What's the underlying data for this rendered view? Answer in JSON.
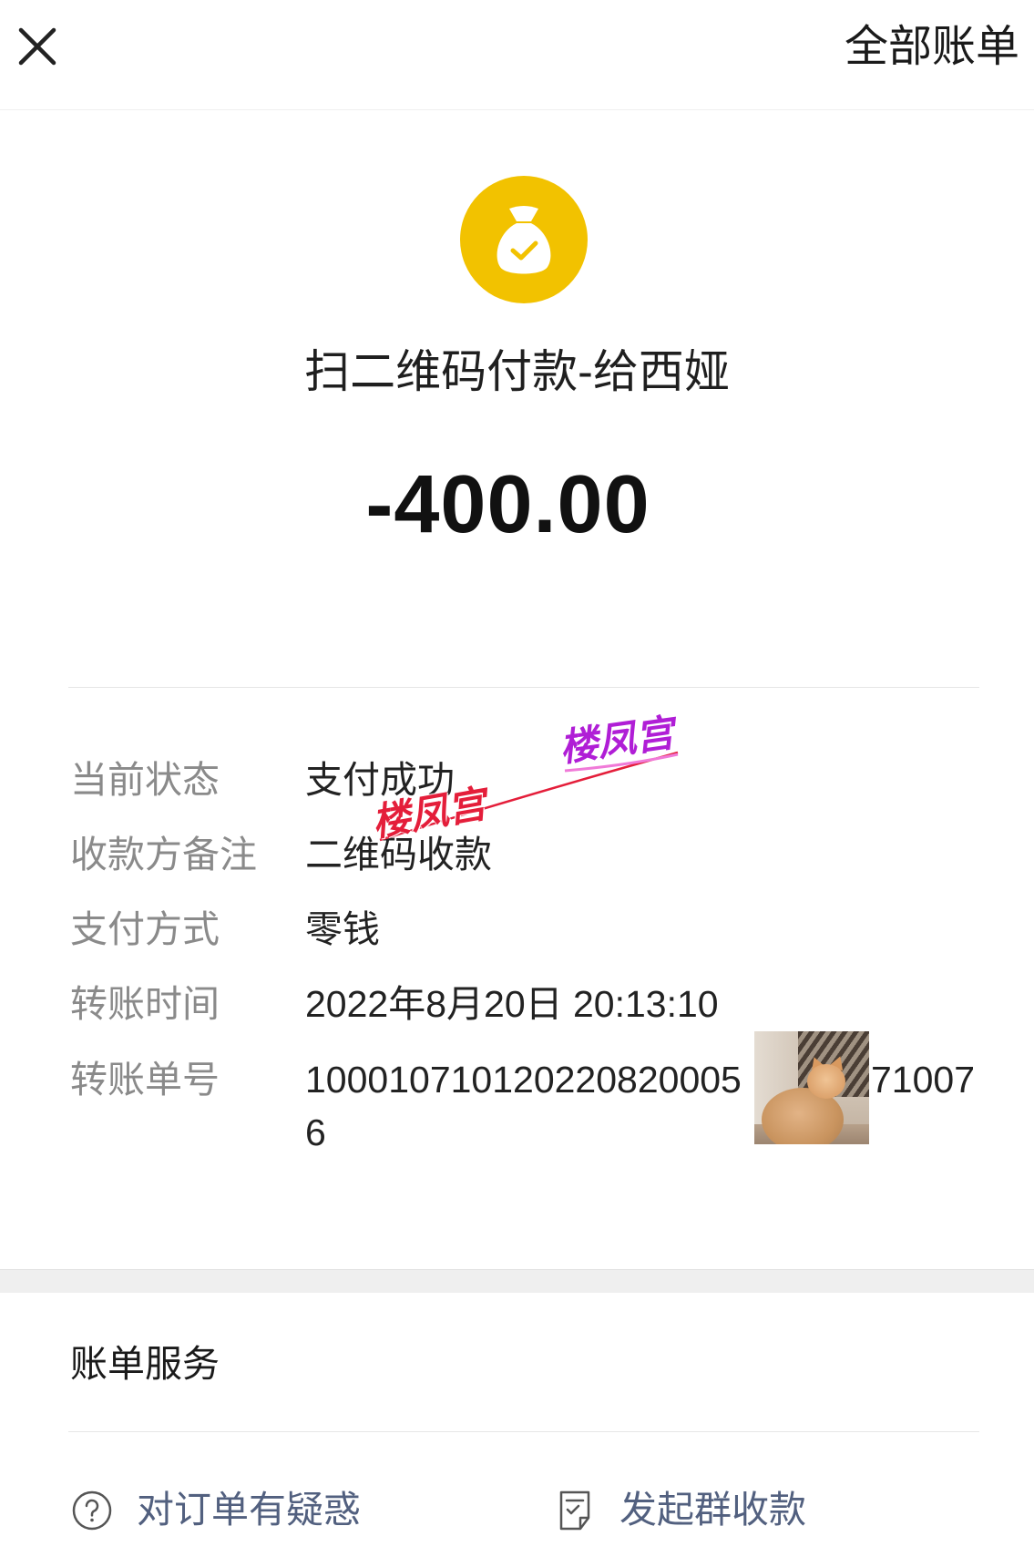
{
  "header": {
    "close_icon": "close-icon",
    "all_bills": "全部账单"
  },
  "summary": {
    "icon": "money-bag-check-icon",
    "icon_color": "#f2c200",
    "title": "扫二维码付款-给西娅",
    "amount": "-400.00"
  },
  "details": {
    "rows": [
      {
        "label": "当前状态",
        "value": "支付成功"
      },
      {
        "label": "收款方备注",
        "value": "二维码收款"
      },
      {
        "label": "支付方式",
        "value": "零钱"
      },
      {
        "label": "转账时间",
        "value": "2022年8月20日 20:13:10"
      },
      {
        "label": "转账单号",
        "value_line1_start": "100010710120220820005",
        "value_line1_end": "71007",
        "value_line2": "6"
      }
    ]
  },
  "watermark": {
    "text_1": "楼凤宫",
    "text_2": "楼凤宫",
    "color_1": "#e41e3a",
    "color_2": "#b01ed6"
  },
  "overlay_photo": {
    "icon": "cat-photo"
  },
  "services": {
    "title": "账单服务",
    "link_color": "#52607f",
    "actions": [
      {
        "icon": "question-circle-icon",
        "label": "对订单有疑惑"
      },
      {
        "icon": "receipt-icon",
        "label": "发起群收款"
      }
    ]
  }
}
